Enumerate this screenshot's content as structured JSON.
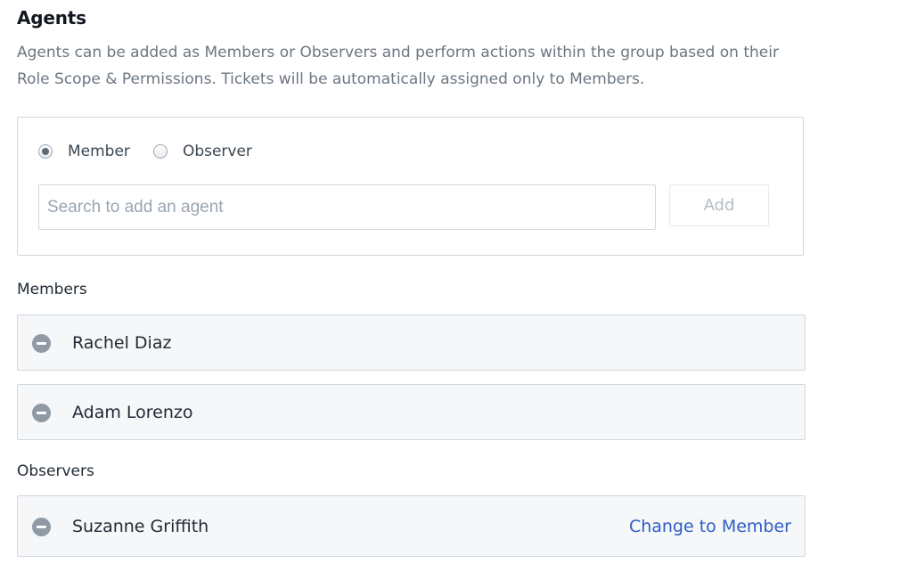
{
  "header": {
    "title": "Agents",
    "description": "Agents can be added as Members or Observers and perform actions within the group based on their Role Scope & Permissions. Tickets will be automatically assigned only to Members."
  },
  "add_agent": {
    "role_options": [
      {
        "label": "Member",
        "selected": true
      },
      {
        "label": "Observer",
        "selected": false
      }
    ],
    "search_placeholder": "Search to add an agent",
    "search_value": "",
    "add_label": "Add"
  },
  "members": {
    "heading": "Members",
    "items": [
      {
        "name": "Rachel Diaz"
      },
      {
        "name": "Adam Lorenzo"
      }
    ]
  },
  "observers": {
    "heading": "Observers",
    "items": [
      {
        "name": "Suzanne Griffith",
        "action_label": "Change to Member"
      }
    ]
  },
  "colors": {
    "link": "#2c5cc5",
    "card_background": "#f5f7f9",
    "border": "#cfd7df",
    "remove_icon": "#8f9aa5"
  },
  "icons": {
    "remove": "minus-circle-icon",
    "radio_selected": "radio-checked-icon",
    "radio_unselected": "radio-unchecked-icon"
  }
}
